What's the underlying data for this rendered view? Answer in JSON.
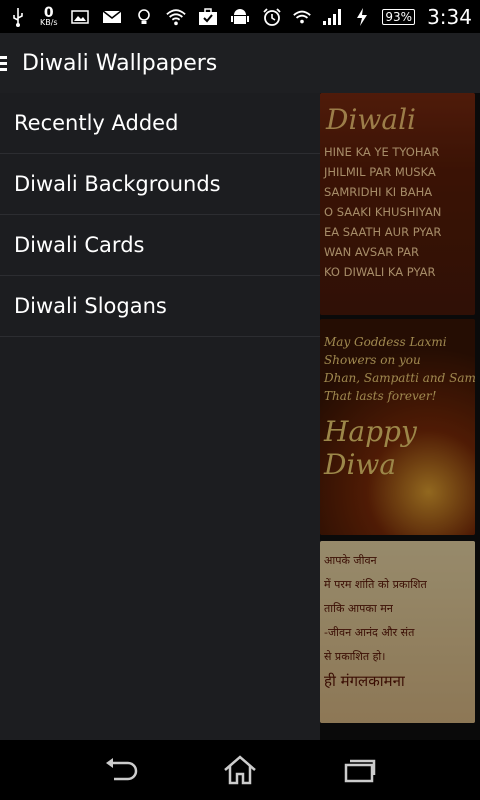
{
  "status_bar": {
    "speed_value": "0",
    "speed_unit": "KB/s",
    "battery": "93%",
    "time": "3:34",
    "icons": [
      "usb-icon",
      "image-icon",
      "mail-icon",
      "bulb-icon",
      "wifi-icon",
      "briefcase-icon",
      "android-icon",
      "alarm-icon",
      "hotspot-icon",
      "signal-icon",
      "charging-icon"
    ]
  },
  "app_bar": {
    "title": "Diwali Wallpapers"
  },
  "drawer": {
    "items": [
      {
        "label": "Recently Added"
      },
      {
        "label": "Diwali Backgrounds"
      },
      {
        "label": "Diwali Cards"
      },
      {
        "label": "Diwali Slogans"
      }
    ]
  },
  "background_cards": {
    "card1": {
      "title": "Diwali",
      "lines": [
        "HINE KA YE TYOHAR",
        "JHILMIL PAR MUSKA",
        "SAMRIDHI KI BAHA",
        "O SAAKI KHUSHIYAN",
        "EA SAATH AUR PYAR",
        "WAN AVSAR PAR",
        "KO DIWALI KA PYAR"
      ]
    },
    "card2": {
      "lines": [
        "May Goddess Laxmi",
        "Showers on you",
        "Dhan, Sampatti and Sam",
        "That lasts forever!"
      ],
      "happy": "Happy Diwa"
    },
    "card3": {
      "lines": [
        "आपके जीवन",
        "में परम शांति को प्रकाशित",
        "ताकि आपका मन",
        "-जीवन आनंद और संत",
        "से प्रकाशित हो।"
      ],
      "footer": "ही मंगलकामना"
    }
  },
  "nav_bar": {
    "icons": [
      "back-icon",
      "home-icon",
      "recent-apps-icon"
    ]
  }
}
